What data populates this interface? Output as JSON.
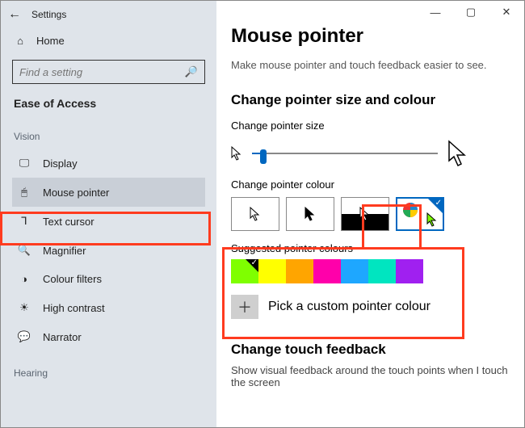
{
  "app": {
    "title": "Settings"
  },
  "window_controls": {
    "min": "—",
    "max": "▢",
    "close": "✕"
  },
  "sidebar": {
    "home": "Home",
    "search_placeholder": "Find a setting",
    "group": "Ease of Access",
    "category_vision": "Vision",
    "category_hearing": "Hearing",
    "items": [
      {
        "label": "Display"
      },
      {
        "label": "Mouse pointer"
      },
      {
        "label": "Text cursor"
      },
      {
        "label": "Magnifier"
      },
      {
        "label": "Colour filters"
      },
      {
        "label": "High contrast"
      },
      {
        "label": "Narrator"
      }
    ]
  },
  "main": {
    "title": "Mouse pointer",
    "subtitle": "Make mouse pointer and touch feedback easier to see.",
    "section_size": "Change pointer size and colour",
    "label_size": "Change pointer size",
    "label_colour": "Change pointer colour",
    "label_suggested": "Suggested pointer colours",
    "custom_label": "Pick a custom pointer colour",
    "section_touch": "Change touch feedback",
    "touch_desc": "Show visual feedback around the touch points when I touch the screen"
  },
  "palette": {
    "colours": [
      "#7FFF00",
      "#FFFF00",
      "#FFA500",
      "#FF00AA",
      "#1EA7FF",
      "#00E5C0",
      "#A020F0"
    ],
    "selected_index": 0
  }
}
